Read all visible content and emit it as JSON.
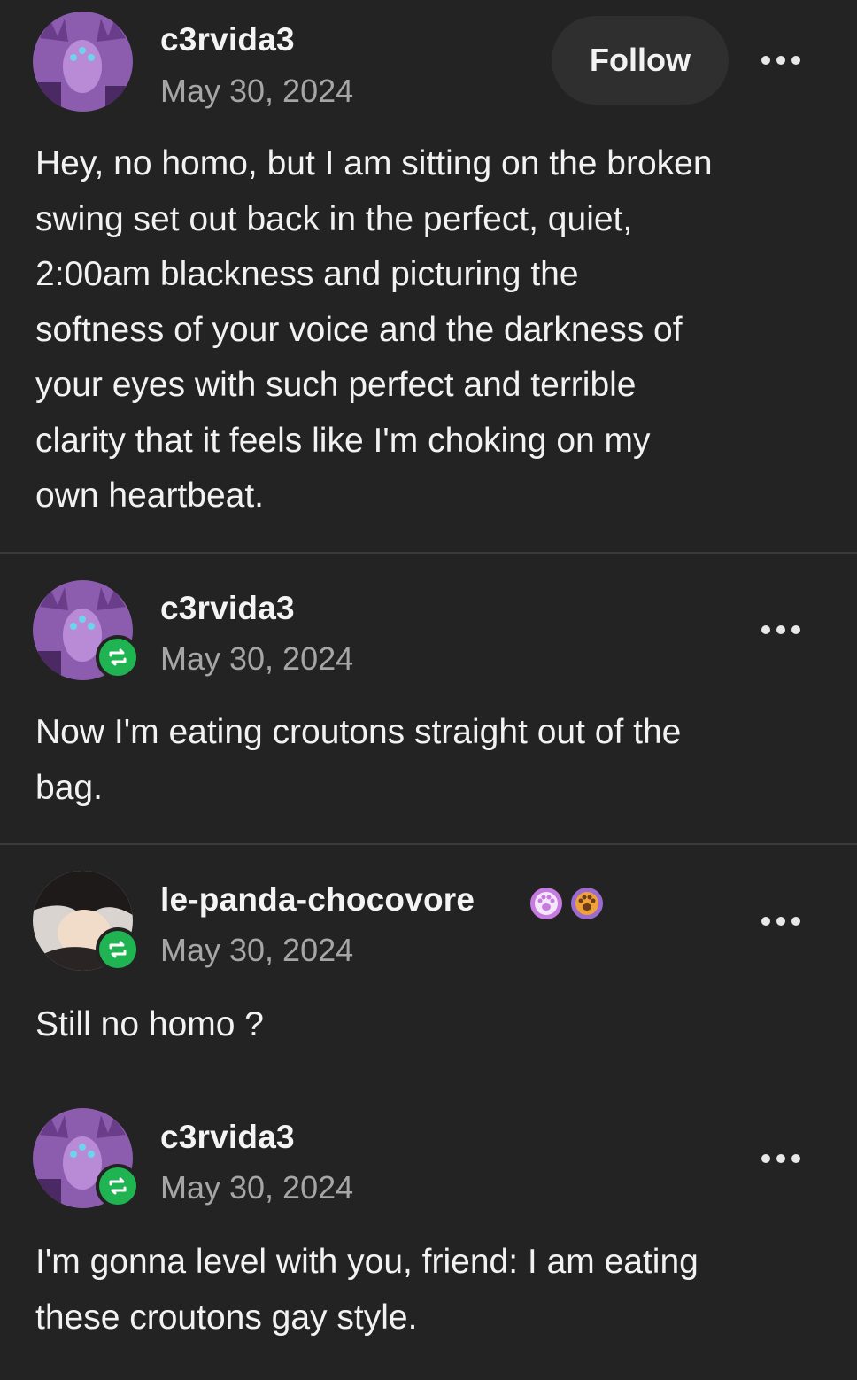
{
  "follow_label": "Follow",
  "posts": [
    {
      "username": "c3rvida3",
      "date": "May 30, 2024",
      "text_lines": [
        "Hey, no homo, but I am sitting on the broken",
        "swing set out back in the perfect, quiet,",
        "2:00am blackness and picturing the",
        "softness of your voice and the darkness of",
        "your eyes with such perfect and terrible",
        "clarity that it feels like I'm choking on my",
        "own heartbeat."
      ]
    },
    {
      "username": "c3rvida3",
      "date": "May 30, 2024",
      "text_lines": [
        "Now I'm eating croutons straight out of the",
        "bag."
      ]
    },
    {
      "username": "le-panda-chocovore",
      "date": "May 30, 2024",
      "text_lines": [
        "Still no homo ?"
      ]
    },
    {
      "username": "c3rvida3",
      "date": "May 30, 2024",
      "text_lines": [
        "I'm gonna level with you, friend: I am eating",
        "these croutons gay style."
      ]
    }
  ],
  "icons": {
    "more": "more-horizontal-icon",
    "reblog": "reblog-icon",
    "paw_badges": [
      "paw-badge-pink-icon",
      "paw-badge-orange-icon"
    ]
  },
  "colors": {
    "background": "#232323",
    "reblog_green": "#1fb451",
    "date_gray": "#a6a6a6",
    "follow_button_bg": "#2f2f2f"
  }
}
